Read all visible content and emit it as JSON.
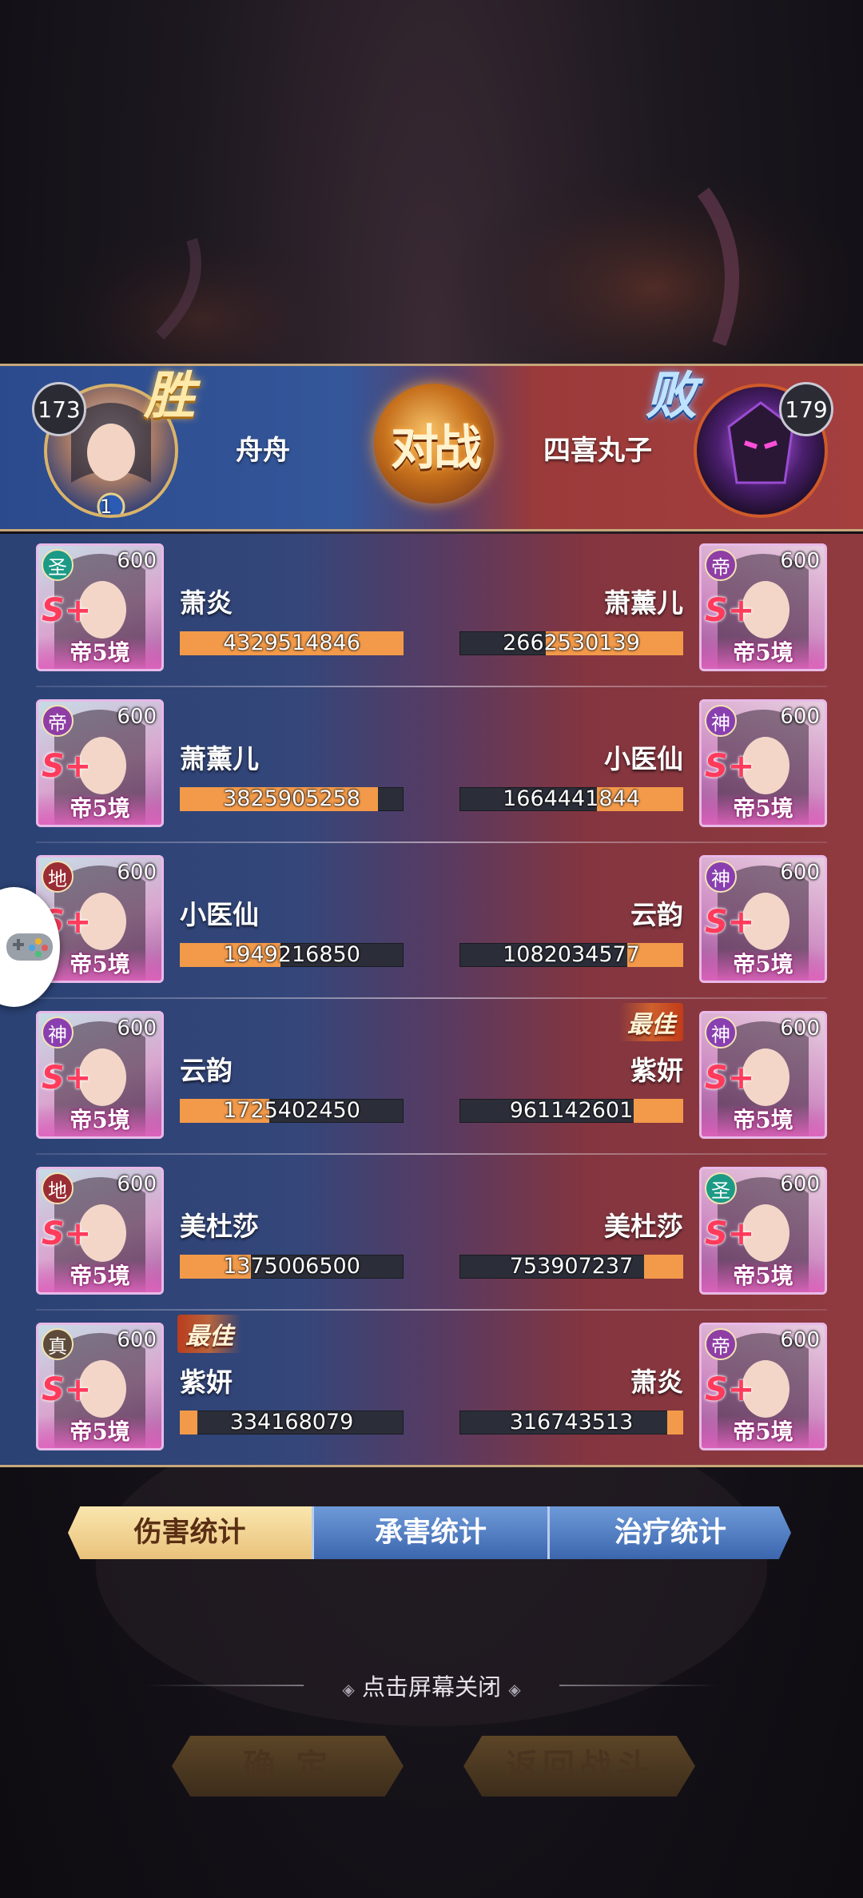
{
  "header": {
    "left_player": {
      "level": "173",
      "result": "胜",
      "name": "舟舟",
      "rank_badge": "1"
    },
    "right_player": {
      "level": "179",
      "result": "败",
      "name": "四喜丸子"
    },
    "vs_label": "对战"
  },
  "colors": {
    "left_team": "#2b4a8d",
    "right_team": "#a43f3e",
    "bar_fill": "#f29a4a",
    "bar_track": "#2b2e38",
    "win_text": "#ffe9a8",
    "lose_text": "#bfe3ff"
  },
  "rows": [
    {
      "left": {
        "grade": "圣",
        "grade_color": "#1c9a86",
        "level": "600",
        "rank": "S+",
        "realm": "帝5境",
        "name": "萧炎",
        "value": "4329514846",
        "fill": 1.0,
        "best": ""
      },
      "right": {
        "grade": "帝",
        "grade_color": "#8f3ea5",
        "level": "600",
        "rank": "S+",
        "realm": "帝5境",
        "name": "萧薰儿",
        "value": "2662530139",
        "fill": 0.615,
        "best": ""
      }
    },
    {
      "left": {
        "grade": "帝",
        "grade_color": "#8f3ea5",
        "level": "600",
        "rank": "S+",
        "realm": "帝5境",
        "name": "萧薰儿",
        "value": "3825905258",
        "fill": 0.884,
        "best": ""
      },
      "right": {
        "grade": "神",
        "grade_color": "#8a3fb0",
        "level": "600",
        "rank": "S+",
        "realm": "帝5境",
        "name": "小医仙",
        "value": "1664441844",
        "fill": 0.384,
        "best": ""
      }
    },
    {
      "left": {
        "grade": "地",
        "grade_color": "#9a2d35",
        "level": "600",
        "rank": "S+",
        "realm": "帝5境",
        "name": "小医仙",
        "value": "1949216850",
        "fill": 0.45,
        "best": ""
      },
      "right": {
        "grade": "神",
        "grade_color": "#8a3fb0",
        "level": "600",
        "rank": "S+",
        "realm": "帝5境",
        "name": "云韵",
        "value": "1082034577",
        "fill": 0.25,
        "best": ""
      }
    },
    {
      "left": {
        "grade": "神",
        "grade_color": "#8a3fb0",
        "level": "600",
        "rank": "S+",
        "realm": "帝5境",
        "name": "云韵",
        "value": "1725402450",
        "fill": 0.399,
        "best": ""
      },
      "right": {
        "grade": "神",
        "grade_color": "#8a3fb0",
        "level": "600",
        "rank": "S+",
        "realm": "帝5境",
        "name": "紫妍",
        "value": "961142601",
        "fill": 0.222,
        "best": "最佳"
      }
    },
    {
      "left": {
        "grade": "地",
        "grade_color": "#9a2d35",
        "level": "600",
        "rank": "S+",
        "realm": "帝5境",
        "name": "美杜莎",
        "value": "1375006500",
        "fill": 0.318,
        "best": ""
      },
      "right": {
        "grade": "圣",
        "grade_color": "#1c9a86",
        "level": "600",
        "rank": "S+",
        "realm": "帝5境",
        "name": "美杜莎",
        "value": "753907237",
        "fill": 0.174,
        "best": ""
      }
    },
    {
      "left": {
        "grade": "真",
        "grade_color": "#5e4a3a",
        "level": "600",
        "rank": "S+",
        "realm": "帝5境",
        "name": "紫妍",
        "value": "334168079",
        "fill": 0.077,
        "best": "最佳"
      },
      "right": {
        "grade": "帝",
        "grade_color": "#8f3ea5",
        "level": "600",
        "rank": "S+",
        "realm": "帝5境",
        "name": "萧炎",
        "value": "316743513",
        "fill": 0.073,
        "best": ""
      }
    }
  ],
  "tabs": [
    {
      "label": "伤害统计",
      "active": true
    },
    {
      "label": "承害统计",
      "active": false
    },
    {
      "label": "治疗统计",
      "active": false
    }
  ],
  "close_hint": "点击屏幕关闭",
  "buttons": {
    "confirm": "确 定",
    "back_to_battle": "返回战斗"
  }
}
